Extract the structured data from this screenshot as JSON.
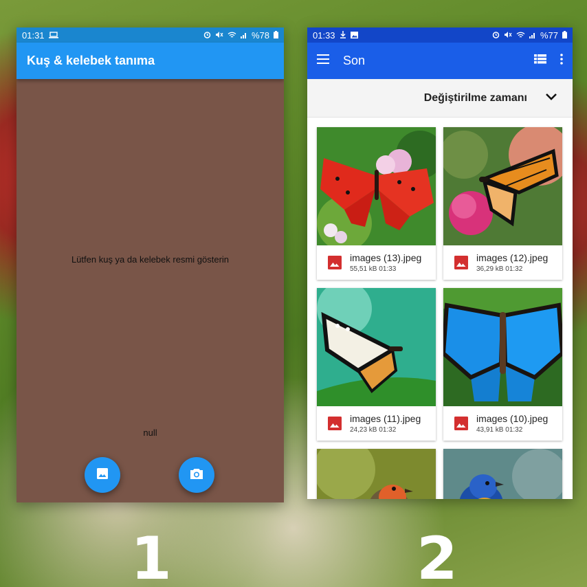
{
  "phone1": {
    "status": {
      "time": "01:31",
      "battery": "%78"
    },
    "title": "Kuş & kelebek tanıma",
    "prompt": "Lütfen kuş ya da kelebek resmi gösterin",
    "result": "null",
    "gallery_icon": "image-icon",
    "camera_icon": "camera-icon"
  },
  "phone2": {
    "status": {
      "time": "01:33",
      "battery": "%77"
    },
    "title": "Son",
    "sort_label": "Değiştirilme zamanı",
    "files": [
      {
        "name": "images (13).jpeg",
        "info": "55,51 kB 01:33"
      },
      {
        "name": "images (12).jpeg",
        "info": "36,29 kB 01:32"
      },
      {
        "name": "images (11).jpeg",
        "info": "24,23 kB 01:32"
      },
      {
        "name": "images (10).jpeg",
        "info": "43,91 kB 01:32"
      }
    ]
  },
  "labels": {
    "first": "1",
    "second": "2"
  },
  "colors": {
    "accent": "#2196f3",
    "panel_bg": "#795548",
    "file_icon": "#d32f2f"
  }
}
